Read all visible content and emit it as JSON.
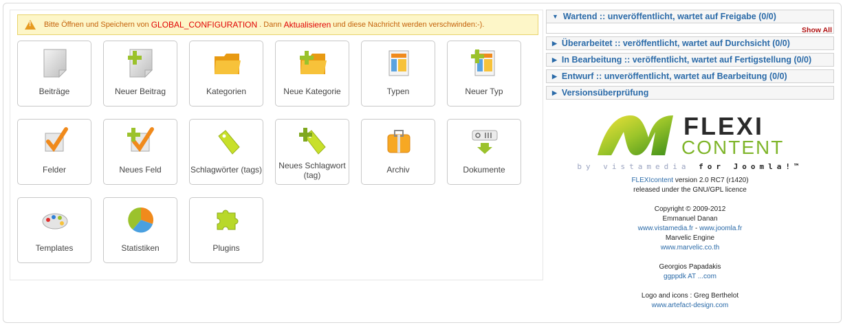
{
  "notice": {
    "before": "Bitte Öffnen und Speichern von",
    "config": "GLOBAL_CONFIGURATION",
    "middle": ". Dann",
    "refresh": "Aktualisieren",
    "after": "und diese Nachricht werden verschwinden:-)."
  },
  "tiles": [
    {
      "label": "Beiträge",
      "icon": "document-icon"
    },
    {
      "label": "Neuer Beitrag",
      "icon": "new-document-icon"
    },
    {
      "label": "Kategorien",
      "icon": "folder-icon"
    },
    {
      "label": "Neue Kategorie",
      "icon": "new-folder-icon"
    },
    {
      "label": "Typen",
      "icon": "types-icon"
    },
    {
      "label": "Neuer Typ",
      "icon": "new-type-icon"
    },
    {
      "label": "Felder",
      "icon": "checkbox-icon"
    },
    {
      "label": "Neues Feld",
      "icon": "new-field-icon"
    },
    {
      "label": "Schlagwörter (tags)",
      "icon": "tag-icon"
    },
    {
      "label": "Neues Schlagwort (tag)",
      "icon": "new-tag-icon"
    },
    {
      "label": "Archiv",
      "icon": "archive-icon"
    },
    {
      "label": "Dokumente",
      "icon": "documents-icon"
    },
    {
      "label": "Templates",
      "icon": "palette-icon"
    },
    {
      "label": "Statistiken",
      "icon": "pie-chart-icon"
    },
    {
      "label": "Plugins",
      "icon": "puzzle-icon"
    }
  ],
  "panels": [
    {
      "label": "Wartend :: unveröffentlicht, wartet auf Freigabe (0/0)",
      "expanded": true
    },
    {
      "label": "Überarbeitet :: veröffentlicht, wartet auf Durchsicht (0/0)",
      "expanded": false
    },
    {
      "label": "In Bearbeitung :: veröffentlicht, wartet auf Fertigstellung (0/0)",
      "expanded": false
    },
    {
      "label": "Entwurf :: unveröffentlicht, wartet auf Bearbeitung (0/0)",
      "expanded": false
    },
    {
      "label": "Versionsüberprüfung",
      "expanded": false
    }
  ],
  "show_all": "Show All",
  "logo": {
    "word1": "FLEXI",
    "word2": "CONTENT",
    "by": "by vistamedia",
    "for": "for Joomla!™"
  },
  "credits": {
    "product_link": "FLEXIcontent",
    "version": "version 2.0 RC7 (r1420)",
    "licence": "released under the GNU/GPL licence",
    "copyright": "Copyright © 2009-2012",
    "author": "Emmanuel Danan",
    "link1": "www.vistamedia.fr",
    "sep": " - ",
    "link2": "www.joomla.fr",
    "engine": "Marvelic Engine",
    "link3": "www.marvelic.co.th",
    "person2": "Georgios Papadakis",
    "email": "ggppdk AT ...com",
    "icons_credit": "Logo and icons : Greg Berthelot",
    "link4": "www.artefact-design.com"
  },
  "colors": {
    "accent": "#2a6aa8",
    "warning": "#e00000",
    "notice_bg": "#fdf6c8",
    "logo_green": "#7fb52a"
  }
}
